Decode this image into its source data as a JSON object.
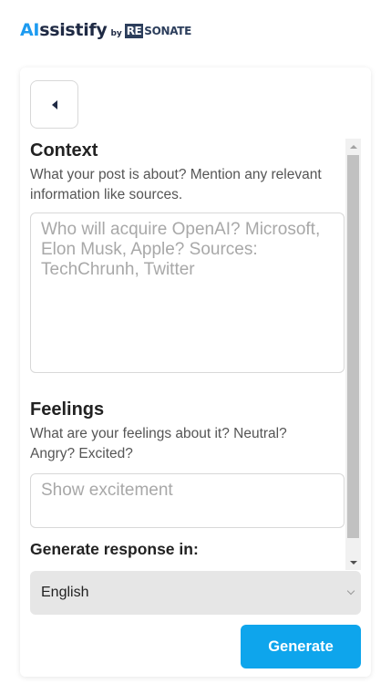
{
  "header": {
    "logo_ai": "AI",
    "logo_rest": "ssistify",
    "logo_by": "by",
    "brand_box": "RE",
    "brand_text": "SONATE"
  },
  "context": {
    "title": "Context",
    "description": "What your post is about? Mention any relevant information like sources.",
    "placeholder": "Who will acquire OpenAI? Microsoft, Elon Musk, Apple? Sources: TechChrunh, Twitter",
    "value": ""
  },
  "feelings": {
    "title": "Feelings",
    "description": "What are your feelings about it? Neutral? Angry? Excited?",
    "placeholder": "Show excitement",
    "value": ""
  },
  "language": {
    "label": "Generate response in:",
    "selected": "English"
  },
  "actions": {
    "generate_label": "Generate"
  },
  "icons": {
    "back": "back-arrow-icon",
    "select_chevron": "chevron-down-icon"
  },
  "colors": {
    "accent": "#0ea5ec",
    "logo_ai": "#1d9bf0",
    "brand_navy": "#2c3e5c"
  }
}
